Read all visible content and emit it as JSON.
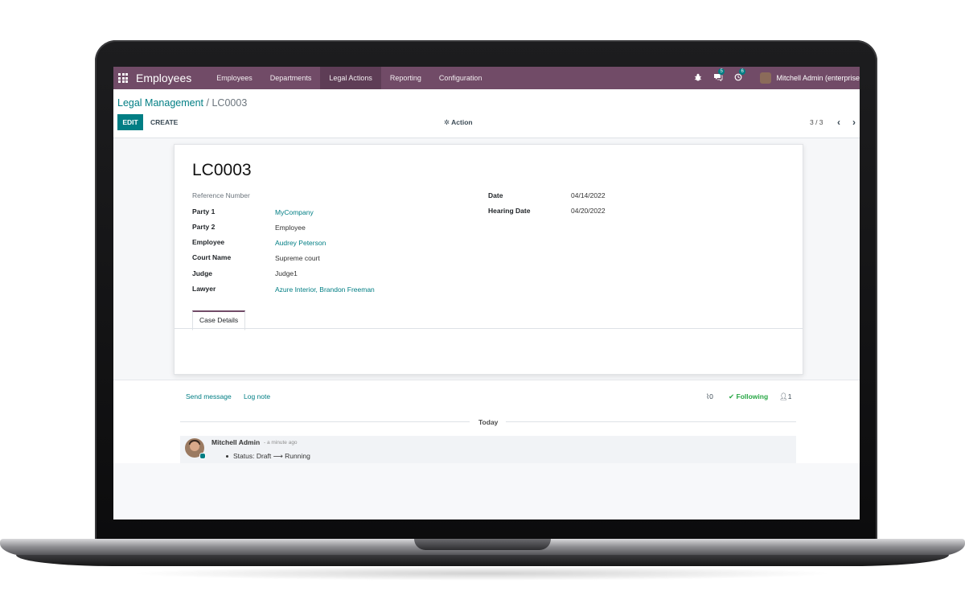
{
  "navbar": {
    "brand": "Employees",
    "menu": [
      "Employees",
      "Departments",
      "Legal Actions",
      "Reporting",
      "Configuration"
    ],
    "active_menu": "Legal Actions",
    "messages_count": "5",
    "activities_count": "6",
    "user": "Mitchell Admin (enterprise"
  },
  "breadcrumb": {
    "parent": "Legal Management",
    "separator": "/",
    "current": "LC0003"
  },
  "toolbar": {
    "edit_label": "EDIT",
    "create_label": "CREATE",
    "action_label": "Action",
    "pager": "3 / 3"
  },
  "record": {
    "name": "LC0003",
    "left_fields": [
      {
        "label": "Reference Number",
        "value": ""
      },
      {
        "label": "Party 1",
        "value": "MyCompany"
      },
      {
        "label": "Party 2",
        "value": "Employee"
      },
      {
        "label": "Employee",
        "value": "Audrey Peterson"
      },
      {
        "label": "Court Name",
        "value": "Supreme court"
      },
      {
        "label": "Judge",
        "value": "Judge1"
      },
      {
        "label": "Lawyer",
        "value": "Azure Interior, Brandon Freeman"
      }
    ],
    "right_fields": [
      {
        "label": "Date",
        "value": "04/14/2022"
      },
      {
        "label": "Hearing Date",
        "value": "04/20/2022"
      }
    ],
    "tab": "Case Details"
  },
  "chatter": {
    "send_message": "Send message",
    "log_note": "Log note",
    "attachments": "0",
    "following": "Following",
    "followers": "1",
    "date_separator": "Today",
    "message": {
      "author": "Mitchell Admin",
      "time": "- a minute ago",
      "tracking": "Status: Draft ⟶ Running"
    }
  },
  "colors": {
    "navbar": "#714b67",
    "primary": "#017e84",
    "following": "#28a745"
  }
}
